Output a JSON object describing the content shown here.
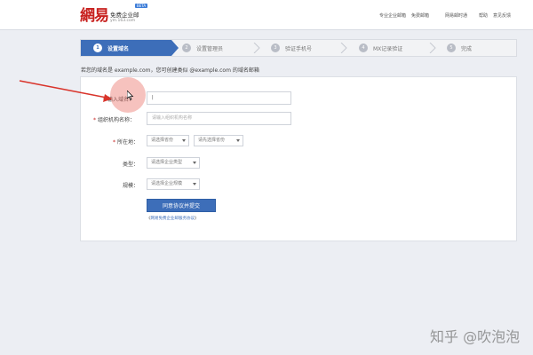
{
  "header": {
    "logo_mark": "網易",
    "logo_title": "免费企业邮",
    "logo_url": "ym.163.com",
    "logo_badge": "BETA",
    "nav": [
      "专业企业邮箱",
      "免费邮箱",
      "网易邮时通",
      "帮助",
      "意见反馈"
    ]
  },
  "steps": [
    {
      "num": "1",
      "label": "设置域名",
      "active": true
    },
    {
      "num": "2",
      "label": "设置管理员",
      "active": false
    },
    {
      "num": "3",
      "label": "验证手机号",
      "active": false
    },
    {
      "num": "4",
      "label": "MX记录验证",
      "active": false
    },
    {
      "num": "5",
      "label": "完成",
      "active": false
    }
  ],
  "intro_text": "若您的域名是 example.com，您可创建类似 @example.com 的域名邮箱",
  "form": {
    "domain": {
      "label": "输入域名：",
      "value": "|"
    },
    "org_name": {
      "label": "组织机构名称：",
      "placeholder": "请输入组织机构名称"
    },
    "location": {
      "label": "所在地：",
      "province": "请选择省份",
      "city": "请先选择省份"
    },
    "type": {
      "label": "类型：",
      "value": "请选择企业类型"
    },
    "scale": {
      "label": "规模：",
      "value": "请选择企业规模"
    },
    "submit_label": "同意协议并提交",
    "agreement_prefix": "《",
    "agreement_link": "网易免费企业邮服务协议",
    "agreement_suffix": "》"
  },
  "watermark": "知乎 @吹泡泡",
  "colors": {
    "brand_red": "#c8211f",
    "accent_blue": "#3d6eb9",
    "annotation_red": "#d9342b"
  }
}
